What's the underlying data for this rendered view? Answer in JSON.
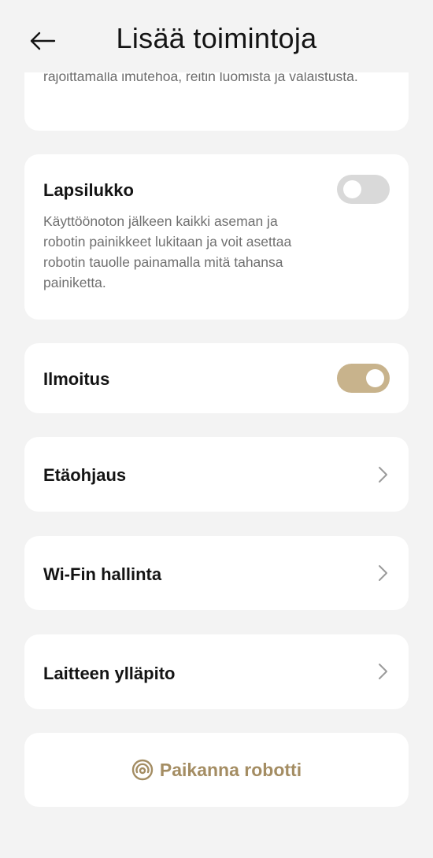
{
  "header": {
    "title": "Lisää toimintoja",
    "back_icon": "arrow-left-icon"
  },
  "cards": {
    "cut_off_text": "rajoittamalla imutehoa, reitin luomista ja valaistusta.",
    "child_lock": {
      "title": "Lapsilukko",
      "description": "Käyttöönoton jälkeen kaikki aseman ja robotin painikkeet lukitaan ja voit asettaa robotin tauolle painamalla mitä tahansa painiketta.",
      "enabled": false
    },
    "notification": {
      "title": "Ilmoitus",
      "enabled": true
    },
    "remote_control": {
      "title": "Etäohjaus"
    },
    "wifi": {
      "title": "Wi-Fin hallinta"
    },
    "maintenance": {
      "title": "Laitteen ylläpito"
    },
    "locate": {
      "label": "Paikanna robotti",
      "icon": "locate-target-icon"
    }
  },
  "colors": {
    "background": "#f3f3f3",
    "card": "#ffffff",
    "toggle_on": "#c8b38c",
    "toggle_off": "#d9d9d9",
    "accent_text": "#a48d63"
  }
}
